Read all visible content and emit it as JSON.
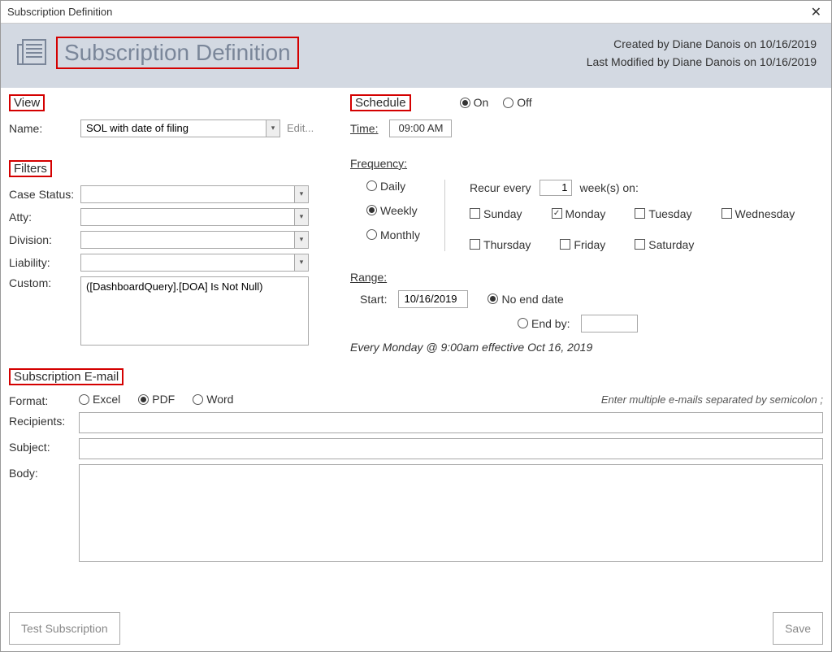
{
  "window": {
    "title": "Subscription Definition"
  },
  "banner": {
    "title": "Subscription Definition",
    "created": "Created by Diane Danois on 10/16/2019",
    "modified": "Last Modified by Diane Danois on 10/16/2019"
  },
  "view": {
    "section_label": "View",
    "name_label": "Name:",
    "name_value": "SOL with date of filing",
    "edit_label": "Edit..."
  },
  "filters": {
    "section_label": "Filters",
    "case_status_label": "Case Status:",
    "case_status_value": "",
    "atty_label": "Atty:",
    "atty_value": "",
    "division_label": "Division:",
    "division_value": "",
    "liability_label": "Liability:",
    "liability_value": "",
    "custom_label": "Custom:",
    "custom_value": "([DashboardQuery].[DOA] Is Not Null)"
  },
  "schedule": {
    "section_label": "Schedule",
    "on_label": "On",
    "off_label": "Off",
    "time_label": "Time:",
    "time_value": "09:00 AM",
    "frequency_label": "Frequency:",
    "daily_label": "Daily",
    "weekly_label": "Weekly",
    "monthly_label": "Monthly",
    "recur_label": "Recur every",
    "recur_value": "1",
    "recur_unit": "week(s) on:",
    "days": {
      "sunday": "Sunday",
      "monday": "Monday",
      "tuesday": "Tuesday",
      "wednesday": "Wednesday",
      "thursday": "Thursday",
      "friday": "Friday",
      "saturday": "Saturday"
    },
    "range_label": "Range:",
    "start_label": "Start:",
    "start_value": "10/16/2019",
    "no_end_label": "No end date",
    "end_by_label": "End by:",
    "end_by_value": "",
    "summary": "Every Monday @ 9:00am effective Oct 16, 2019"
  },
  "email": {
    "section_label": "Subscription E-mail",
    "format_label": "Format:",
    "excel_label": "Excel",
    "pdf_label": "PDF",
    "word_label": "Word",
    "hint": "Enter multiple e-mails separated by semicolon ;",
    "recipients_label": "Recipients:",
    "recipients_value": "",
    "subject_label": "Subject:",
    "subject_value": "",
    "body_label": "Body:",
    "body_value": ""
  },
  "footer": {
    "test_label": "Test Subscription",
    "save_label": "Save"
  }
}
